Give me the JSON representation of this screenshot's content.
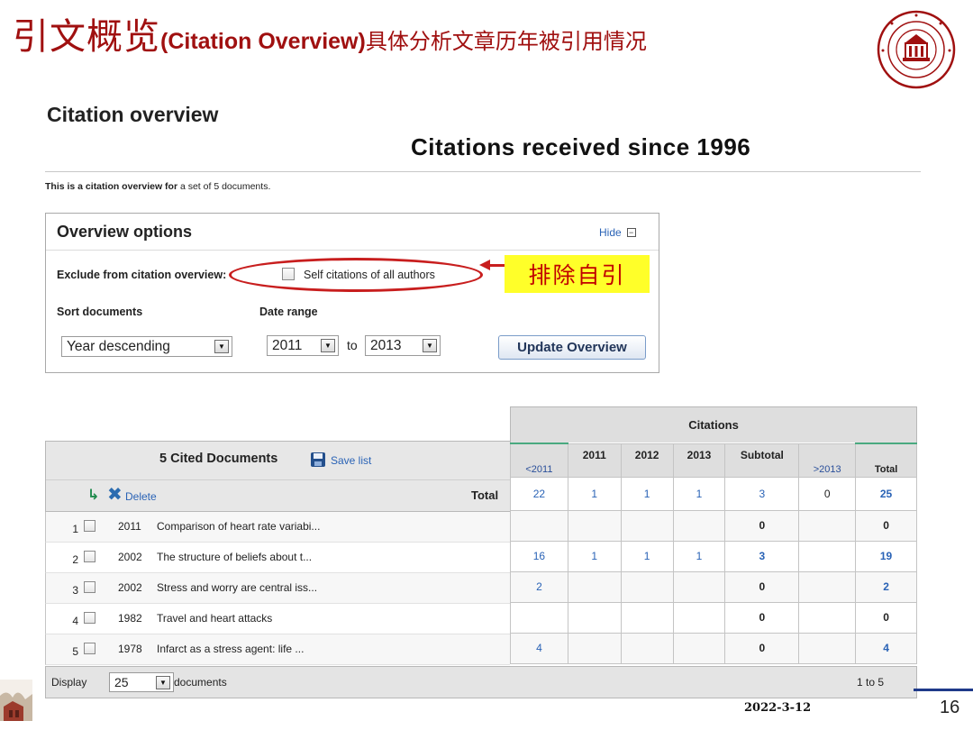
{
  "slide": {
    "title_cn_big": "引文概览",
    "title_en": "(Citation Overview)",
    "title_cn_small": "具体分析文章历年被引用情况",
    "footer_date": "2022-3-12",
    "page_number": "16",
    "accent_color": "#a01010"
  },
  "page": {
    "heading": "Citation overview",
    "subheading": "Citations received since 1996",
    "intro_bold": "This is a citation overview for",
    "intro_rest": " a set of 5 documents."
  },
  "options": {
    "title": "Overview options",
    "hide_label": "Hide",
    "hide_icon": "minus",
    "exclude_label": "Exclude from citation overview:",
    "self_citations_label": "Self citations of all authors",
    "self_citations_checked": false,
    "sort_label": "Sort documents",
    "sort_value": "Year descending",
    "date_label": "Date range",
    "date_from": "2011",
    "date_to_word": "to",
    "date_to": "2013",
    "update_button": "Update Overview"
  },
  "annotation": {
    "callout_text": "排除自引",
    "callout_bg": "#ffff29",
    "callout_color": "#c00000"
  },
  "table": {
    "citations_header": "Citations",
    "cited_docs_label": "5 Cited Documents",
    "save_list_label": "Save list",
    "delete_label": "Delete",
    "total_label": "Total",
    "columns": [
      "<2011",
      "2011",
      "2012",
      "2013",
      "Subtotal",
      ">2013",
      "Total"
    ],
    "totals": [
      "22",
      "1",
      "1",
      "1",
      "3",
      "0",
      "25"
    ],
    "rows": [
      {
        "num": "1",
        "year": "2011",
        "title": "Comparison of heart rate variabi...",
        "cells": [
          "",
          "",
          "",
          "",
          "0",
          "",
          "0"
        ]
      },
      {
        "num": "2",
        "year": "2002",
        "title": "The structure of beliefs about t...",
        "cells": [
          "16",
          "1",
          "1",
          "1",
          "3",
          "",
          "19"
        ]
      },
      {
        "num": "3",
        "year": "2002",
        "title": "Stress and worry are central iss...",
        "cells": [
          "2",
          "",
          "",
          "",
          "0",
          "",
          "2"
        ]
      },
      {
        "num": "4",
        "year": "1982",
        "title": "Travel and heart attacks",
        "cells": [
          "",
          "",
          "",
          "",
          "0",
          "",
          "0"
        ]
      },
      {
        "num": "5",
        "year": "1978",
        "title": "Infarct as a stress agent: life ...",
        "cells": [
          "4",
          "",
          "",
          "",
          "0",
          "",
          "4"
        ]
      }
    ],
    "display_label": "Display",
    "display_value": "25",
    "display_suffix": "documents",
    "range_label": "1 to 5"
  }
}
